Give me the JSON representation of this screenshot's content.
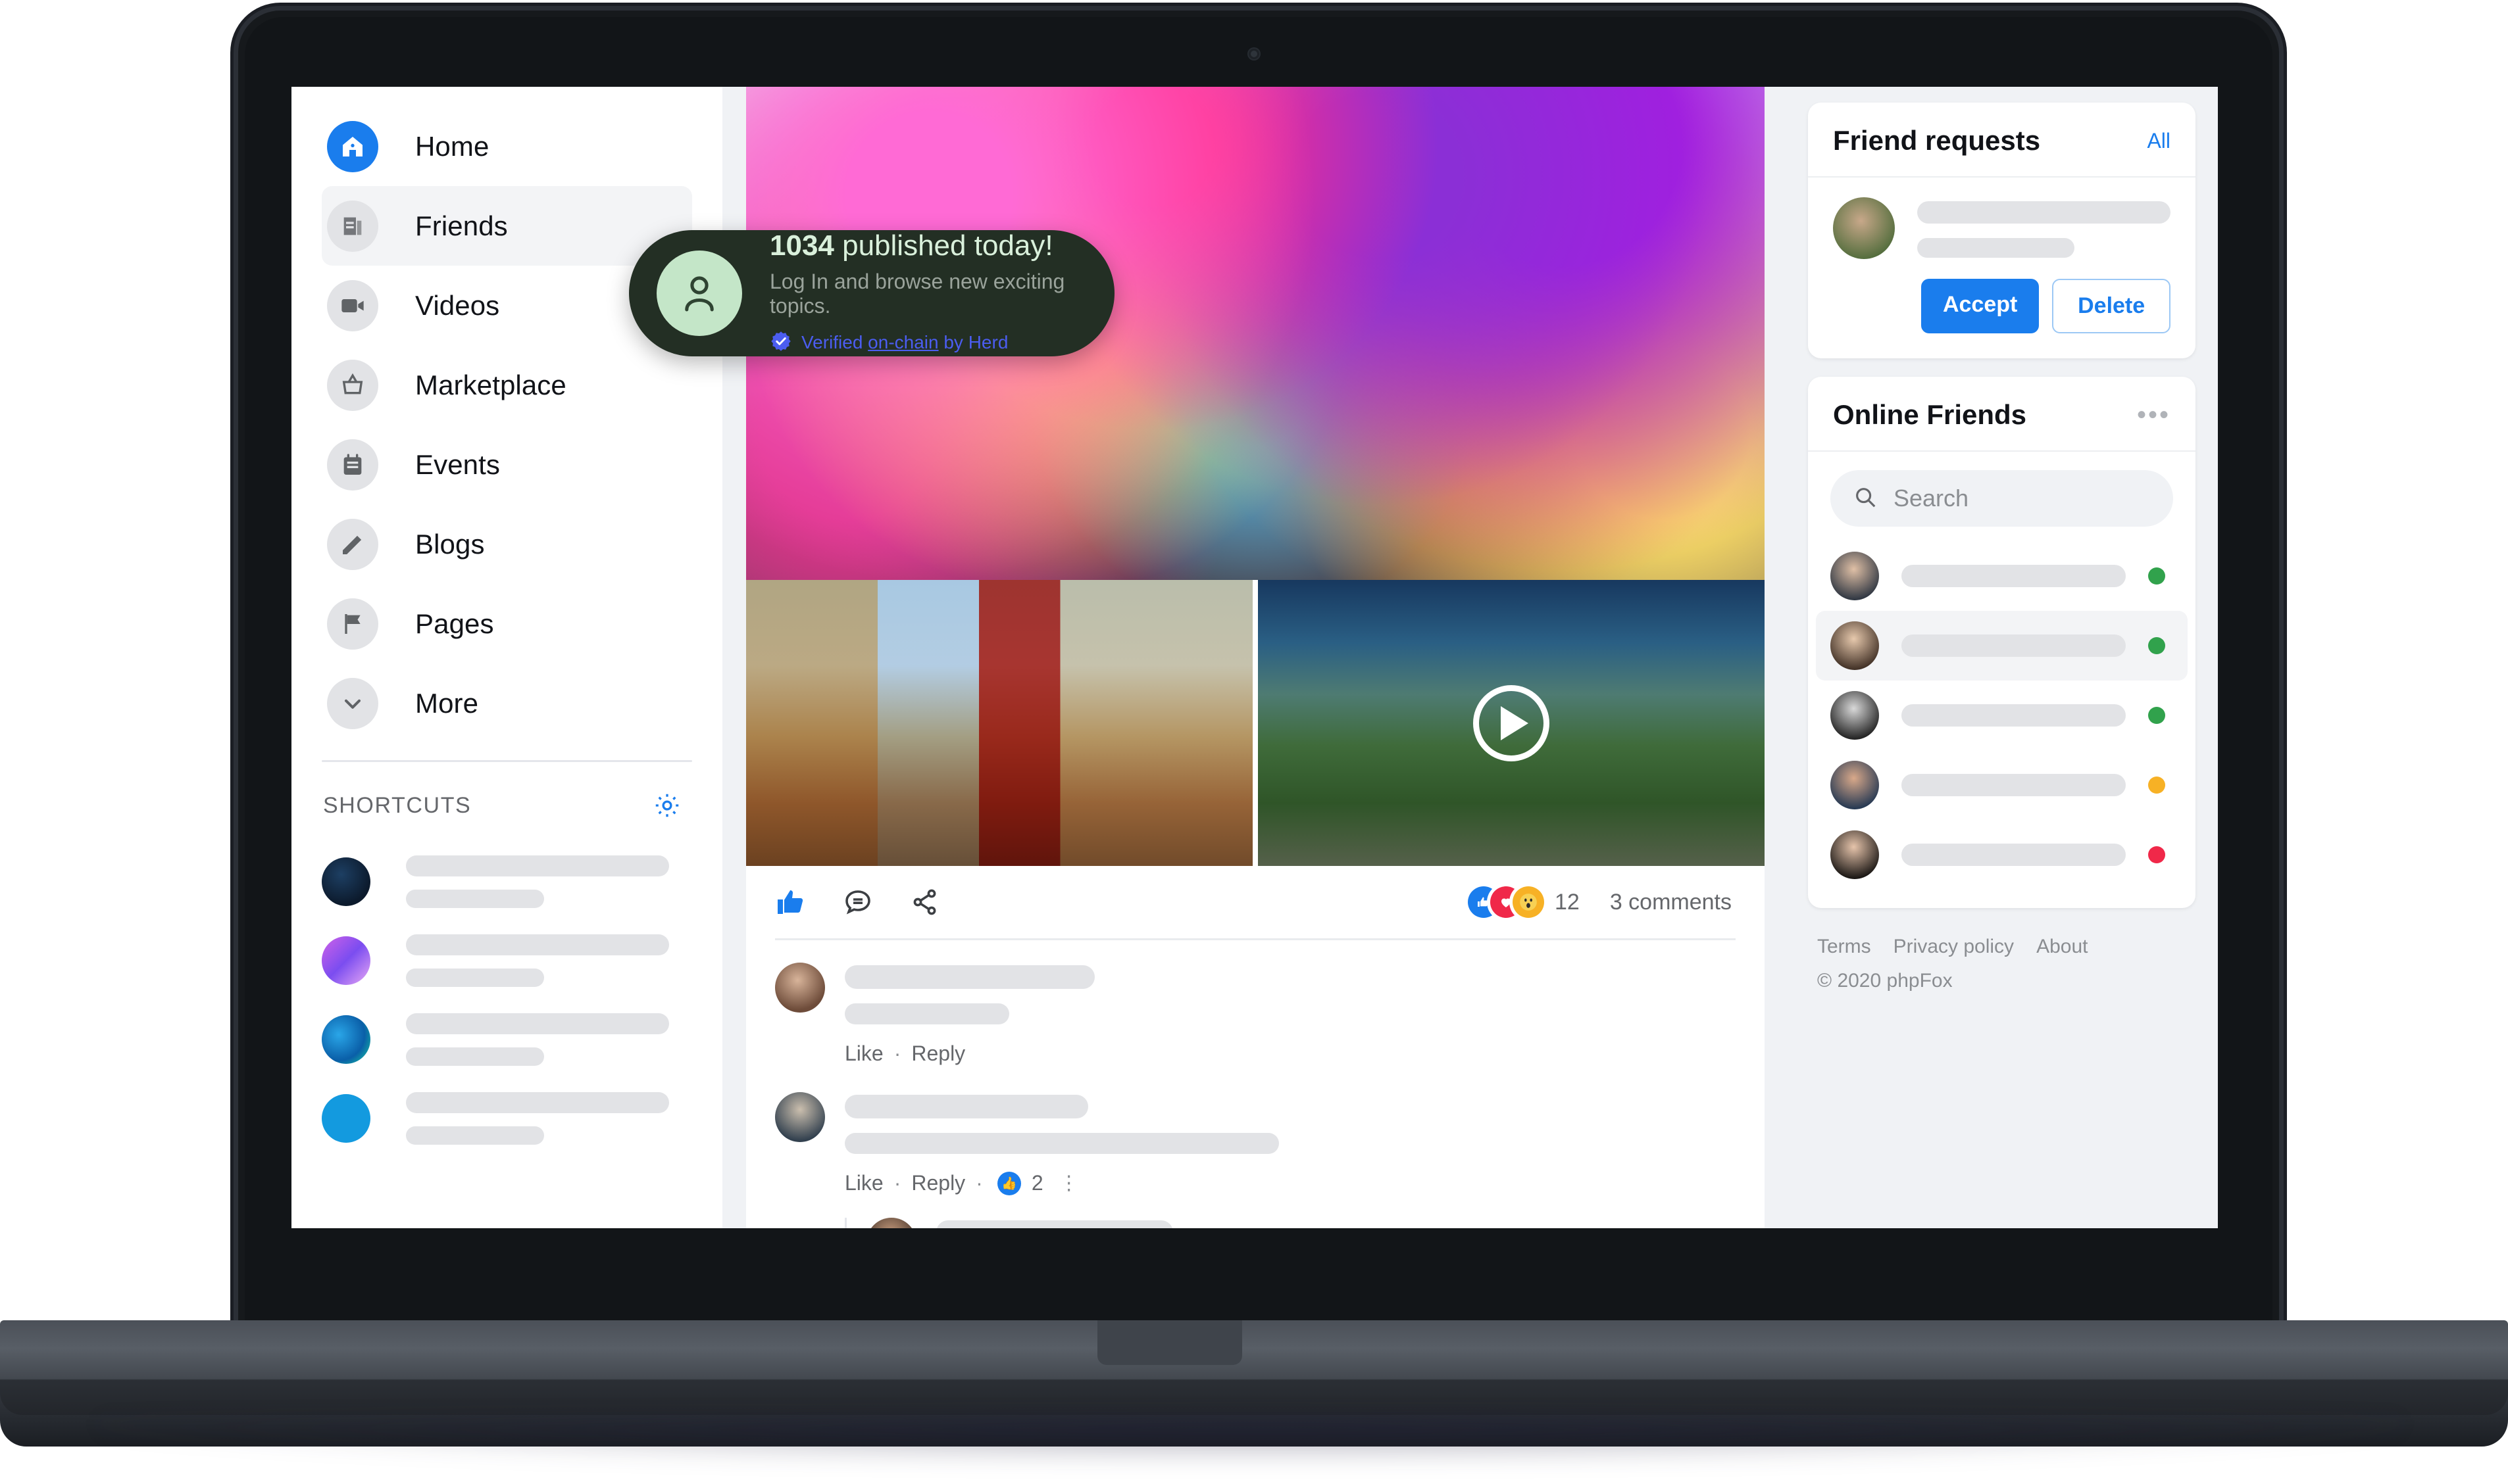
{
  "device": {
    "type": "laptop"
  },
  "toast": {
    "count": "1034",
    "title_rest": " published today!",
    "subtitle": "Log In and browse new exciting topics.",
    "verified_prefix": "Verified ",
    "verified_link": "on-chain",
    "verified_suffix": " by Herd",
    "avatar_icon": "person-icon",
    "check_icon": "verified-badge-icon",
    "bg_color": "#232f24",
    "title_color": "#d9f0db",
    "link_color": "#4b5df0"
  },
  "sidebar": {
    "items": [
      {
        "label": "Home",
        "icon": "home-icon",
        "active": true
      },
      {
        "label": "Friends",
        "icon": "friends-icon",
        "selected": true
      },
      {
        "label": "Videos",
        "icon": "video-camera-icon"
      },
      {
        "label": "Marketplace",
        "icon": "shopping-basket-icon"
      },
      {
        "label": "Events",
        "icon": "calendar-icon"
      },
      {
        "label": "Blogs",
        "icon": "pencil-icon"
      },
      {
        "label": "Pages",
        "icon": "flag-icon"
      },
      {
        "label": "More",
        "icon": "chevron-down-icon"
      }
    ],
    "shortcuts_title": "SHORTCUTS",
    "shortcuts_gear_icon": "gear-icon",
    "shortcuts": [
      {
        "avatar": "shortcut-avatar-1"
      },
      {
        "avatar": "shortcut-avatar-2"
      },
      {
        "avatar": "shortcut-avatar-3"
      },
      {
        "avatar": "shortcut-avatar-4"
      }
    ]
  },
  "feed": {
    "hero_image": "holi-festival-color-powder-crowd",
    "tiles": [
      {
        "image": "italian-town-street-buildings",
        "type": "photo"
      },
      {
        "image": "mountain-hiker-green-valley",
        "type": "video",
        "play_icon": "play-icon"
      }
    ],
    "actions": [
      {
        "name": "like-button",
        "icon": "thumbs-up-icon"
      },
      {
        "name": "comment-button",
        "icon": "comment-bubble-icon"
      },
      {
        "name": "share-button",
        "icon": "share-icon"
      }
    ],
    "reactions": [
      {
        "name": "like",
        "glyph": "👍",
        "color": "#1a7ded"
      },
      {
        "name": "love",
        "glyph": "❤",
        "color": "#f02849"
      },
      {
        "name": "wow",
        "glyph": "😮",
        "color": "#f7b125"
      }
    ],
    "reaction_count": "12",
    "comments_label": "3 comments",
    "comments": [
      {
        "avatar": "comment-avatar-1",
        "like_label": "Like",
        "sep": "·",
        "reply_label": "Reply"
      },
      {
        "avatar": "comment-avatar-2",
        "like_label": "Like",
        "sep": "·",
        "reply_label": "Reply",
        "reaction_count": "2",
        "kebab": "⋮"
      },
      {
        "avatar": "comment-avatar-3"
      }
    ]
  },
  "friend_requests": {
    "title": "Friend requests",
    "all_label": "All",
    "avatar": "friend-request-avatar",
    "accept_label": "Accept",
    "delete_label": "Delete"
  },
  "online_friends": {
    "title": "Online Friends",
    "menu_icon": "ellipsis-icon",
    "search_placeholder": "Search",
    "search_value": "",
    "search_icon": "search-icon",
    "friends": [
      {
        "avatar": "friend-avatar-1",
        "status": "online",
        "status_color": "#31a24c"
      },
      {
        "avatar": "friend-avatar-2",
        "status": "online",
        "status_color": "#31a24c",
        "hover": true
      },
      {
        "avatar": "friend-avatar-3",
        "status": "online",
        "status_color": "#31a24c"
      },
      {
        "avatar": "friend-avatar-4",
        "status": "away",
        "status_color": "#f7b125"
      },
      {
        "avatar": "friend-avatar-5",
        "status": "busy",
        "status_color": "#f02849"
      }
    ]
  },
  "footer": {
    "links": [
      "Terms",
      "Privacy policy",
      "About"
    ],
    "copyright": "© 2020 phpFox"
  },
  "theme": {
    "accent": "#1a7ded",
    "bg": "#f0f2f5",
    "card": "#ffffff",
    "text": "#111318",
    "muted": "#65676b"
  }
}
